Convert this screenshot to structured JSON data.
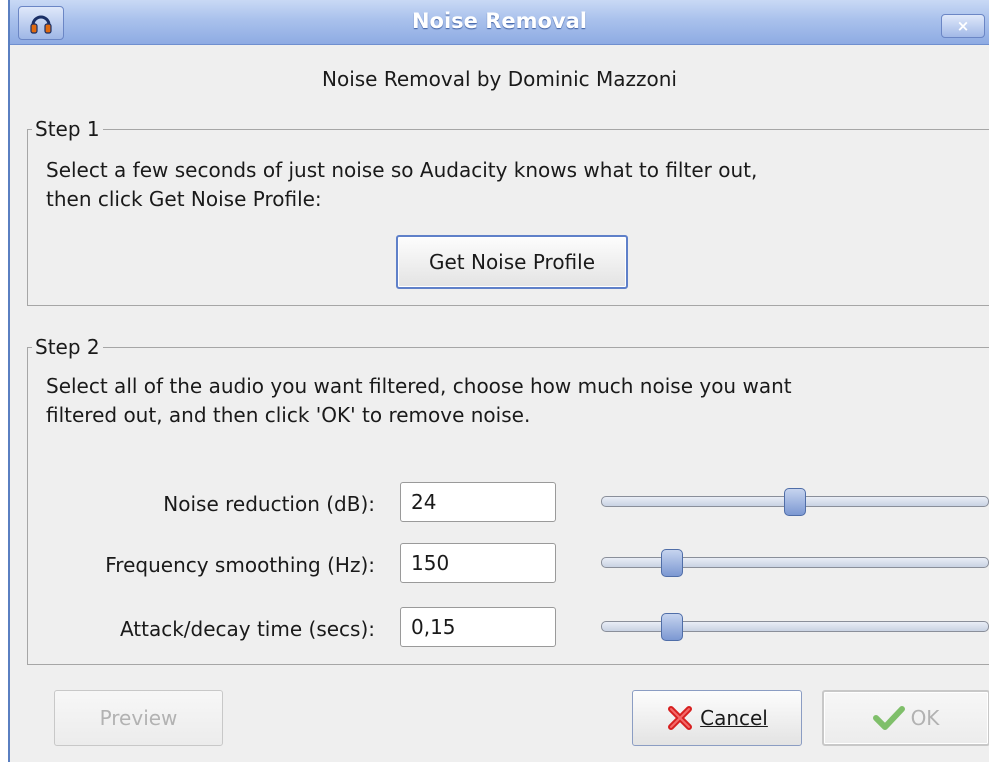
{
  "window": {
    "title": "Noise Removal",
    "close_label": "×",
    "subtitle": "Noise Removal by Dominic Mazzoni"
  },
  "step1": {
    "legend": "Step 1",
    "description_line1": "Select a few seconds of just noise so Audacity knows what to filter out,",
    "description_line2": "then click Get Noise Profile:",
    "button_label": "Get Noise Profile"
  },
  "step2": {
    "legend": "Step 2",
    "description_line1": "Select all of the audio you want filtered, choose how much noise you want",
    "description_line2": "filtered out, and then click 'OK' to remove noise.",
    "fields": [
      {
        "label": "Noise reduction (dB):",
        "value": "24",
        "slider_fraction": 0.5
      },
      {
        "label": "Frequency smoothing (Hz):",
        "value": "150",
        "slider_fraction": 0.165
      },
      {
        "label": "Attack/decay time (secs):",
        "value": "0,15",
        "slider_fraction": 0.165
      }
    ]
  },
  "buttons": {
    "preview": "Preview",
    "cancel": "Cancel",
    "ok": "OK"
  },
  "icons": {
    "app": "audacity-headphones-icon",
    "close": "close-icon",
    "cancel": "red-x-icon",
    "ok": "green-check-icon"
  },
  "colors": {
    "titlebar": "#9fb8e8",
    "focus_border": "#5f80c9",
    "slider_handle": "#7c98d2"
  }
}
